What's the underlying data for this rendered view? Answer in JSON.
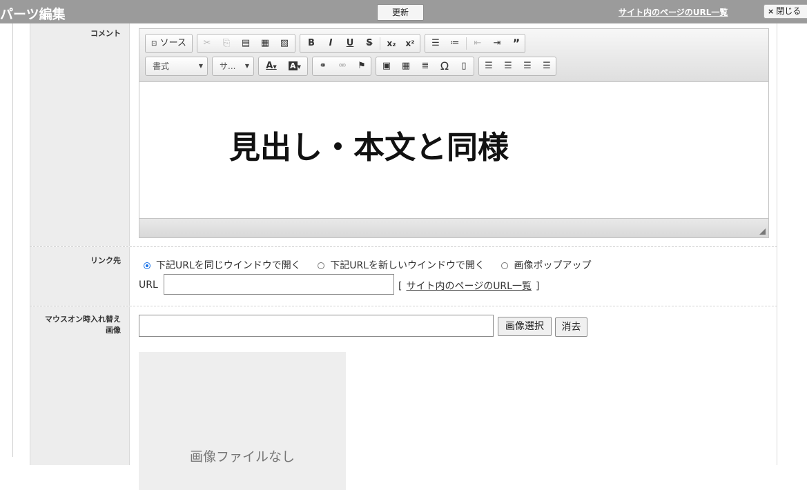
{
  "header": {
    "title": "パーツ編集",
    "update_label": "更新",
    "url_list_link": "サイト内のページのURL一覧",
    "close_label": "閉じる",
    "close_icon": "×"
  },
  "comment_row": {
    "label": "コメント",
    "toolbar": {
      "source_label": "ソース",
      "format_combo": "書式",
      "size_combo": "サ..."
    },
    "content_text": "見出し・本文と同様"
  },
  "link_row": {
    "label": "リンク先",
    "options": [
      {
        "label": "下記URLを同じウインドウで開く",
        "selected": true
      },
      {
        "label": "下記URLを新しいウインドウで開く",
        "selected": false
      },
      {
        "label": "画像ポップアップ",
        "selected": false
      }
    ],
    "url_label": "URL",
    "url_value": "",
    "bracket_open": "[",
    "bracket_close": "]",
    "url_list_link": "サイト内のページのURL一覧"
  },
  "image_row": {
    "label_line1": "マウスオン時入れ替え",
    "label_line2": "画像",
    "input_value": "",
    "select_button": "画像選択",
    "clear_button": "消去",
    "no_image_text": "画像ファイルなし"
  },
  "colors": {
    "header_bg": "#9b9b9b",
    "label_bg": "#ededed",
    "radio_accent": "#1a73e8"
  }
}
